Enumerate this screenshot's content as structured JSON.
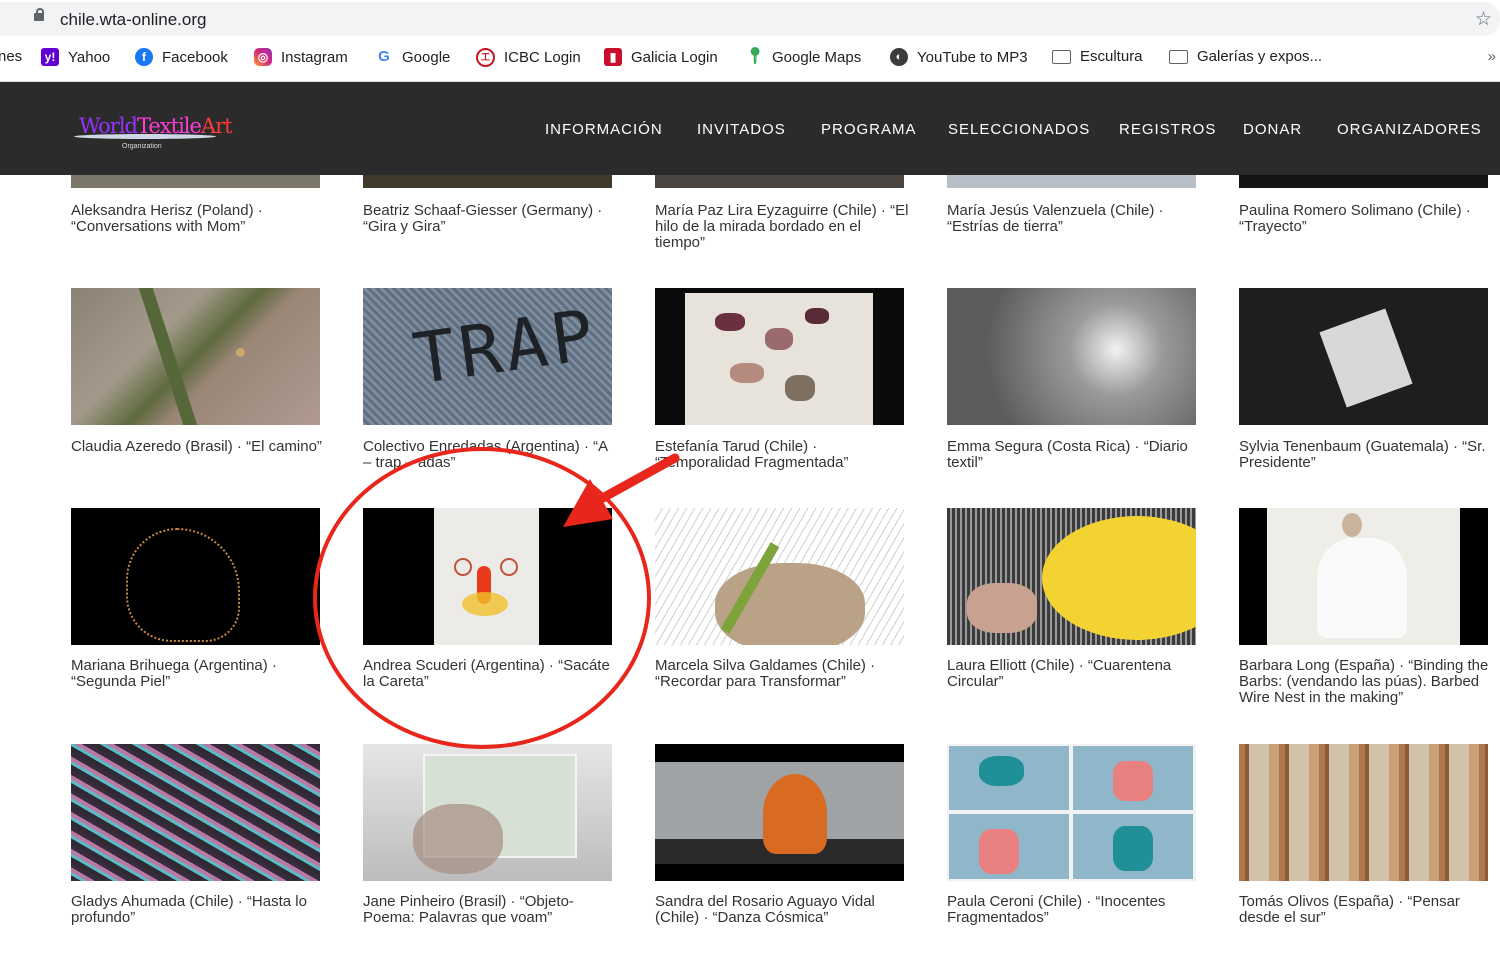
{
  "browser": {
    "url": "chile.wta-online.org",
    "bookmarks": [
      {
        "label": "nes",
        "icon": "none"
      },
      {
        "label": "Yahoo",
        "icon": "yahoo-icon"
      },
      {
        "label": "Facebook",
        "icon": "facebook-icon"
      },
      {
        "label": "Instagram",
        "icon": "instagram-icon"
      },
      {
        "label": "Google",
        "icon": "google-icon"
      },
      {
        "label": "ICBC Login",
        "icon": "icbc-icon"
      },
      {
        "label": "Galicia Login",
        "icon": "galicia-icon"
      },
      {
        "label": "Google Maps",
        "icon": "maps-pin-icon"
      },
      {
        "label": "YouTube to MP3",
        "icon": "globe-icon"
      },
      {
        "label": "Escultura",
        "icon": "folder-icon"
      },
      {
        "label": "Galerías y expos...",
        "icon": "folder-icon"
      }
    ],
    "overflow": "»"
  },
  "site": {
    "logo": {
      "word1": "World",
      "word2": "Textile",
      "word3": "Art",
      "sub": "Organization"
    },
    "nav": [
      "INFORMACIÓN",
      "INVITADOS",
      "PROGRAMA",
      "SELECCIONADOS",
      "REGISTROS",
      "DONAR",
      "ORGANIZADORES"
    ]
  },
  "gallery": {
    "row0": [
      "Aleksandra Herisz (Poland) · “Conversations with Mom”",
      "Beatriz Schaaf-Giesser (Germany) · “Gira y Gira”",
      "María Paz Lira Eyzaguirre (Chile) · “El hilo de la mirada bordado en el tiempo”",
      "María Jesús Valenzuela (Chile) · “Estrías de tierra”",
      "Paulina Romero Solimano (Chile) · “Trayecto”"
    ],
    "row1": [
      "Claudia Azeredo (Brasil) · “El camino”",
      "Colectivo Enredadas (Argentina) · “A – trap – adas”",
      "Estefanía Tarud (Chile) · “Temporalidad Fragmentada”",
      "Emma Segura (Costa Rica) · “Diario textil”",
      "Sylvia Tenenbaum (Guatemala) · “Sr. Presidente”"
    ],
    "row2": [
      "Mariana Brihuega (Argentina) · “Segunda Piel”",
      "Andrea Scuderi (Argentina) · “Sacáte la Careta”",
      "Marcela Silva Galdames (Chile) · “Recordar para Transformar”",
      "Laura Elliott (Chile) · “Cuarentena Circular”",
      "Barbara Long (España) · “Binding the Barbs: (vendando las púas). Barbed Wire Nest in the making”"
    ],
    "row3": [
      "Gladys Ahumada (Chile) · “Hasta lo profundo”",
      "Jane Pinheiro (Brasil) · “Objeto-Poema: Palavras que voam”",
      "Sandra del Rosario Aguayo Vidal (Chile) · “Danza Cósmica”",
      "Paula Ceroni (Chile) · “Inocentes Fragmentados”",
      "Tomás Olivos (España) · “Pensar desde el sur”"
    ],
    "thumb_text": {
      "trap": "TRAP"
    }
  },
  "colors": {
    "header_bg": "#2b2b2b",
    "annotation": "#e8261b",
    "logo_purple": "#9b30ff",
    "logo_pink": "#ff3bd8"
  }
}
